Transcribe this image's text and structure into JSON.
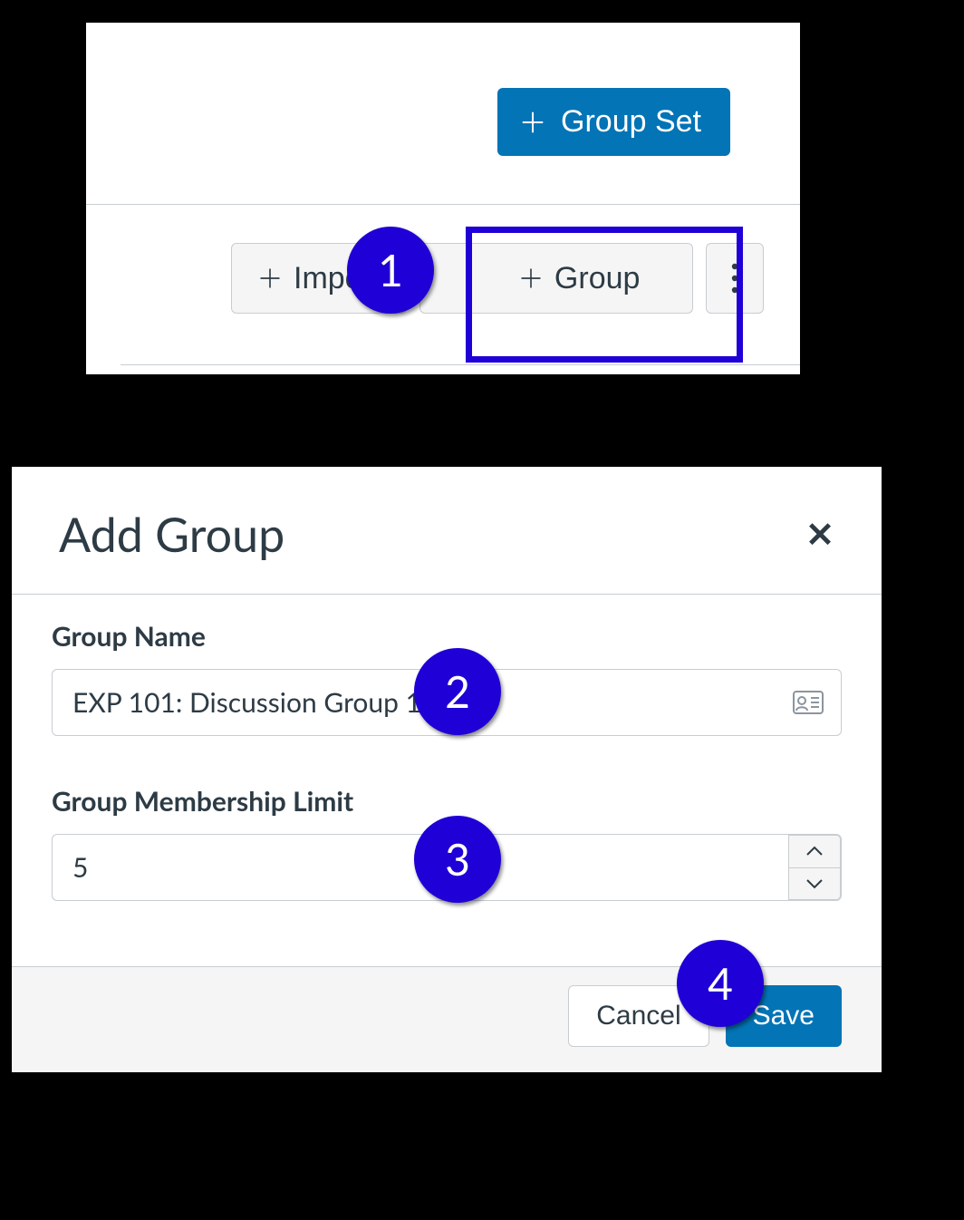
{
  "top": {
    "group_set_label": "Group Set",
    "import_label": "Import",
    "group_label": "Group"
  },
  "dialog": {
    "title": "Add Group",
    "group_name_label": "Group Name",
    "group_name_value": "EXP 101: Discussion Group 1",
    "limit_label": "Group Membership Limit",
    "limit_value": "5",
    "cancel_label": "Cancel",
    "save_label": "Save"
  },
  "callouts": {
    "n1": "1",
    "n2": "2",
    "n3": "3",
    "n4": "4"
  }
}
